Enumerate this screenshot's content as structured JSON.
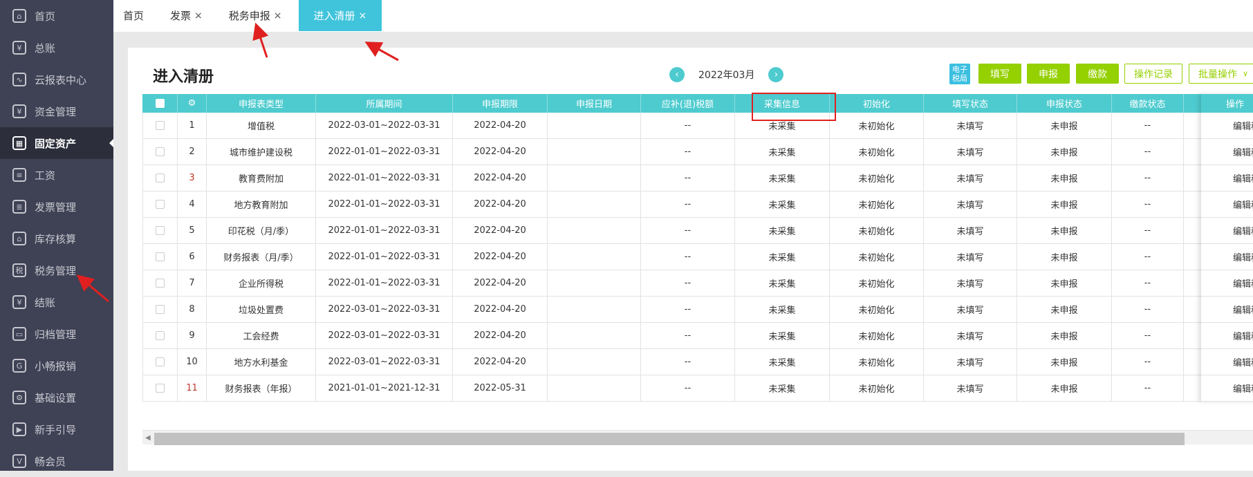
{
  "sidebar": {
    "items": [
      {
        "label": "首页",
        "icon": "home-icon",
        "glyph": "⌂"
      },
      {
        "label": "总账",
        "icon": "ledger-icon",
        "glyph": "¥"
      },
      {
        "label": "云报表中心",
        "icon": "chart-icon",
        "glyph": "∿"
      },
      {
        "label": "资金管理",
        "icon": "money-bag-icon",
        "glyph": "¥"
      },
      {
        "label": "固定资产",
        "icon": "building-icon",
        "glyph": "▦",
        "active": true
      },
      {
        "label": "工资",
        "icon": "salary-icon",
        "glyph": "≡"
      },
      {
        "label": "发票管理",
        "icon": "invoice-icon",
        "glyph": "≣"
      },
      {
        "label": "库存核算",
        "icon": "warehouse-icon",
        "glyph": "⌂"
      },
      {
        "label": "税务管理",
        "icon": "tax-icon",
        "glyph": "税"
      },
      {
        "label": "结账",
        "icon": "checkout-icon",
        "glyph": "¥"
      },
      {
        "label": "归档管理",
        "icon": "archive-icon",
        "glyph": "▭"
      },
      {
        "label": "小畅报销",
        "icon": "reimburse-icon",
        "glyph": "G"
      },
      {
        "label": "基础设置",
        "icon": "gear-icon",
        "glyph": "⚙"
      },
      {
        "label": "新手引导",
        "icon": "video-icon",
        "glyph": "▶"
      },
      {
        "label": "畅会员",
        "icon": "vip-icon",
        "glyph": "V"
      }
    ]
  },
  "tabs": [
    {
      "label": "首页",
      "closable": false
    },
    {
      "label": "发票",
      "closable": true
    },
    {
      "label": "税务申报",
      "closable": true
    },
    {
      "label": "进入清册",
      "closable": true,
      "active": true
    }
  ],
  "close_glyph": "×",
  "page": {
    "title": "进入清册",
    "month": "2022年03月",
    "prev": "‹",
    "next": "›"
  },
  "toolbar": {
    "etax_label": "电子税局",
    "fill": "填写",
    "declare": "申报",
    "pay": "缴款",
    "log": "操作记录",
    "batch": "批量操作",
    "batch_caret": "∨"
  },
  "colors": {
    "accent": "#4ecbcf",
    "green": "#95d000",
    "tab_active": "#40c4dc",
    "sidebar": "#3f4155",
    "annotation": "#e02020"
  },
  "table": {
    "columns": [
      "",
      "⚙",
      "申报表类型",
      "所属期间",
      "申报期限",
      "申报日期",
      "应补(退)税额",
      "采集信息",
      "初始化",
      "填写状态",
      "申报状态",
      "缴款状态",
      "操作"
    ],
    "rows": [
      {
        "no": "1",
        "type": "增值税",
        "period": "2022-03-01~2022-03-31",
        "deadline": "2022-04-20",
        "date": "",
        "amount": "--",
        "collect": "未采集",
        "init": "未初始化",
        "fill": "未填写",
        "declare": "未申报",
        "pay": "--",
        "op": "编辑税"
      },
      {
        "no": "2",
        "type": "城市维护建设税",
        "period": "2022-01-01~2022-03-31",
        "deadline": "2022-04-20",
        "date": "",
        "amount": "--",
        "collect": "未采集",
        "init": "未初始化",
        "fill": "未填写",
        "declare": "未申报",
        "pay": "--",
        "op": "编辑税"
      },
      {
        "no": "3",
        "type": "教育费附加",
        "period": "2022-01-01~2022-03-31",
        "deadline": "2022-04-20",
        "date": "",
        "amount": "--",
        "collect": "未采集",
        "init": "未初始化",
        "fill": "未填写",
        "declare": "未申报",
        "pay": "--",
        "op": "编辑税",
        "red": true
      },
      {
        "no": "4",
        "type": "地方教育附加",
        "period": "2022-01-01~2022-03-31",
        "deadline": "2022-04-20",
        "date": "",
        "amount": "--",
        "collect": "未采集",
        "init": "未初始化",
        "fill": "未填写",
        "declare": "未申报",
        "pay": "--",
        "op": "编辑税"
      },
      {
        "no": "5",
        "type": "印花税（月/季）",
        "period": "2022-01-01~2022-03-31",
        "deadline": "2022-04-20",
        "date": "",
        "amount": "--",
        "collect": "未采集",
        "init": "未初始化",
        "fill": "未填写",
        "declare": "未申报",
        "pay": "--",
        "op": "编辑税"
      },
      {
        "no": "6",
        "type": "财务报表（月/季）",
        "period": "2022-01-01~2022-03-31",
        "deadline": "2022-04-20",
        "date": "",
        "amount": "--",
        "collect": "未采集",
        "init": "未初始化",
        "fill": "未填写",
        "declare": "未申报",
        "pay": "--",
        "op": "编辑税"
      },
      {
        "no": "7",
        "type": "企业所得税",
        "period": "2022-01-01~2022-03-31",
        "deadline": "2022-04-20",
        "date": "",
        "amount": "--",
        "collect": "未采集",
        "init": "未初始化",
        "fill": "未填写",
        "declare": "未申报",
        "pay": "--",
        "op": "编辑税"
      },
      {
        "no": "8",
        "type": "垃圾处置费",
        "period": "2022-03-01~2022-03-31",
        "deadline": "2022-04-20",
        "date": "",
        "amount": "--",
        "collect": "未采集",
        "init": "未初始化",
        "fill": "未填写",
        "declare": "未申报",
        "pay": "--",
        "op": "编辑税"
      },
      {
        "no": "9",
        "type": "工会经费",
        "period": "2022-03-01~2022-03-31",
        "deadline": "2022-04-20",
        "date": "",
        "amount": "--",
        "collect": "未采集",
        "init": "未初始化",
        "fill": "未填写",
        "declare": "未申报",
        "pay": "--",
        "op": "编辑税"
      },
      {
        "no": "10",
        "type": "地方水利基金",
        "period": "2022-03-01~2022-03-31",
        "deadline": "2022-04-20",
        "date": "",
        "amount": "--",
        "collect": "未采集",
        "init": "未初始化",
        "fill": "未填写",
        "declare": "未申报",
        "pay": "--",
        "op": "编辑税"
      },
      {
        "no": "11",
        "type": "财务报表（年报）",
        "period": "2021-01-01~2021-12-31",
        "deadline": "2022-05-31",
        "date": "",
        "amount": "--",
        "collect": "未采集",
        "init": "未初始化",
        "fill": "未填写",
        "declare": "未申报",
        "pay": "--",
        "op": "编辑税",
        "red": true
      }
    ]
  }
}
